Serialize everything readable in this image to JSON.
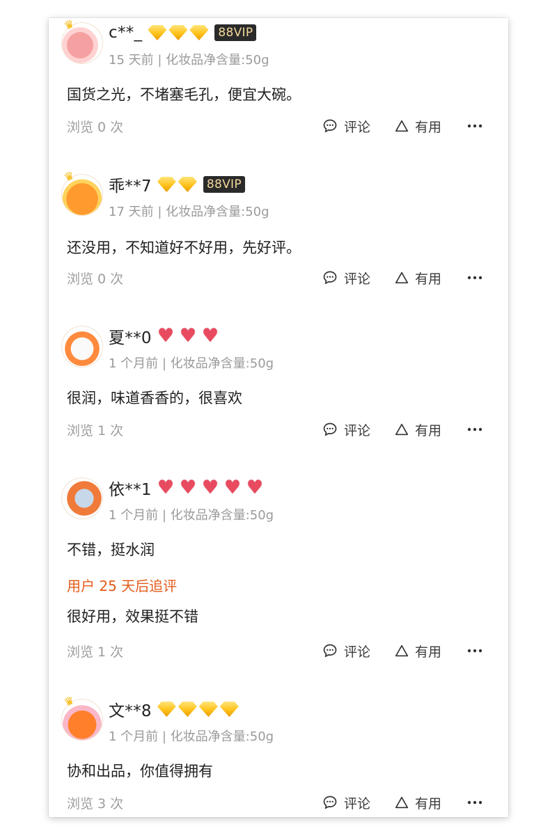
{
  "actions": {
    "comment_label": "评论",
    "useful_label": "有用"
  },
  "colors": {
    "accent_followup": "#e45c1a",
    "muted": "#9a9a9a",
    "vip_bg": "#2a2a2a"
  },
  "reviews": [
    {
      "username": "c**_",
      "badge_type": "diamond",
      "badge_count": 3,
      "vip": "88VIP",
      "meta": "15 天前 | 化妆品净含量:50g",
      "text": "国货之光，不堵塞毛孔，便宜大碗。",
      "views": "浏览 0 次"
    },
    {
      "username": "乖**7",
      "badge_type": "diamond",
      "badge_count": 2,
      "vip": "88VIP",
      "meta": "17 天前 | 化妆品净含量:50g",
      "text": "还没用，不知道好不好用，先好评。",
      "views": "浏览 0 次"
    },
    {
      "username": "夏**0",
      "badge_type": "heart",
      "badge_count": 3,
      "meta": "1 个月前 | 化妆品净含量:50g",
      "text": "很润，味道香香的，很喜欢",
      "views": "浏览 1 次"
    },
    {
      "username": "依**1",
      "badge_type": "heart",
      "badge_count": 5,
      "meta": "1 个月前 | 化妆品净含量:50g",
      "text": "不错，挺水润",
      "followup_label": "用户 25 天后追评",
      "followup_text": "很好用，效果挺不错",
      "views": "浏览 1 次"
    },
    {
      "username": "文**8",
      "badge_type": "diamond",
      "badge_count": 4,
      "meta": "1 个月前 | 化妆品净含量:50g",
      "text": "协和出品，你值得拥有",
      "views": "浏览 3 次"
    }
  ]
}
